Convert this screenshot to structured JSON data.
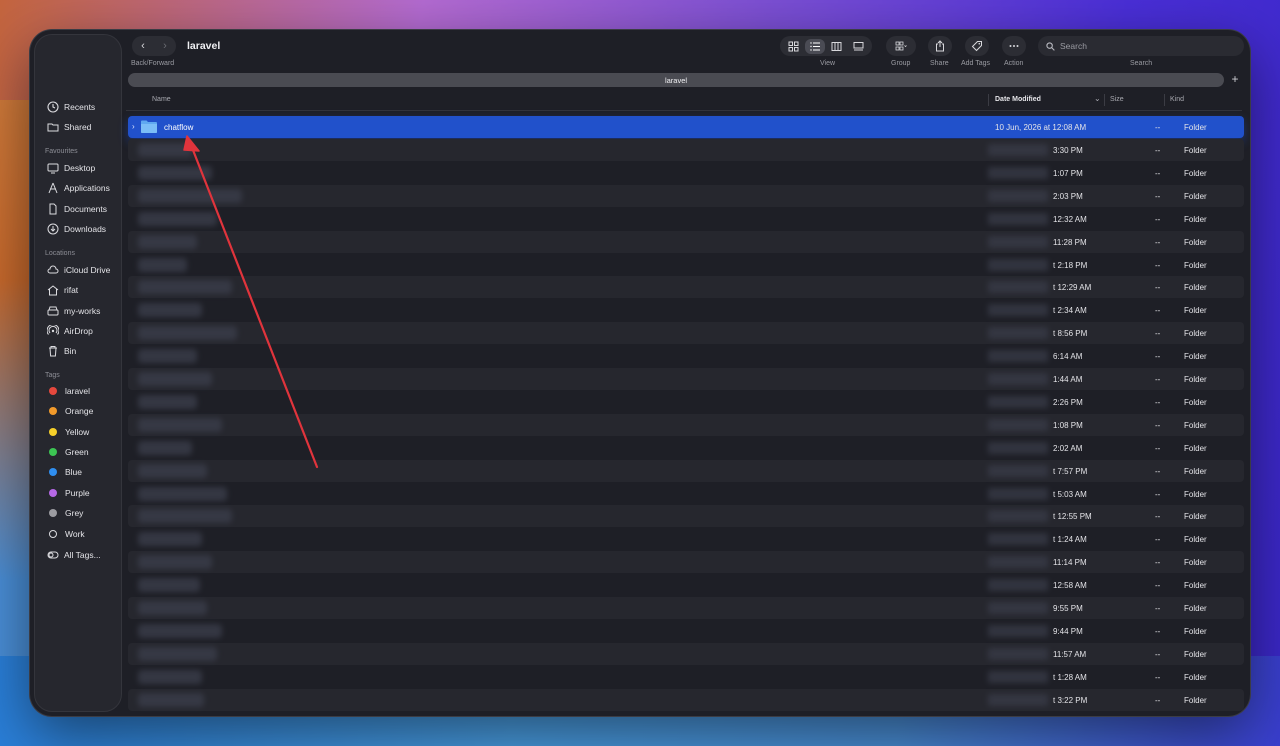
{
  "window": {
    "folder_title": "laravel",
    "back_forward_label": "Back/Forward",
    "view_label": "View",
    "group_label": "Group",
    "share_label": "Share",
    "add_tags_label": "Add Tags",
    "action_label": "Action",
    "search_label": "Search",
    "search_placeholder": "Search",
    "tab_title": "laravel"
  },
  "sidebar": {
    "top_items": [
      {
        "label": "Recents",
        "icon": "clock-icon"
      },
      {
        "label": "Shared",
        "icon": "shared-folder-icon"
      }
    ],
    "favourites_title": "Favourites",
    "favourites": [
      {
        "label": "Desktop",
        "icon": "desktop-icon"
      },
      {
        "label": "Applications",
        "icon": "applications-icon"
      },
      {
        "label": "Documents",
        "icon": "document-icon"
      },
      {
        "label": "Downloads",
        "icon": "download-icon"
      }
    ],
    "locations_title": "Locations",
    "locations": [
      {
        "label": "iCloud Drive",
        "icon": "cloud-icon"
      },
      {
        "label": "rifat",
        "icon": "home-icon"
      },
      {
        "label": "my-works",
        "icon": "drive-icon"
      },
      {
        "label": "AirDrop",
        "icon": "airdrop-icon"
      },
      {
        "label": "Bin",
        "icon": "trash-icon"
      }
    ],
    "tags_title": "Tags",
    "tags": [
      {
        "label": "laravel",
        "color": "#e5483d"
      },
      {
        "label": "Orange",
        "color": "#f19a2b"
      },
      {
        "label": "Yellow",
        "color": "#f5cf2a"
      },
      {
        "label": "Green",
        "color": "#3cc553"
      },
      {
        "label": "Blue",
        "color": "#2f8ef0"
      },
      {
        "label": "Purple",
        "color": "#b668e6"
      },
      {
        "label": "Grey",
        "color": "#9c9ca1"
      },
      {
        "label": "Work",
        "color": ""
      },
      {
        "label": "All Tags...",
        "color": ""
      }
    ]
  },
  "columns": {
    "name": "Name",
    "date_modified": "Date Modified",
    "size": "Size",
    "kind": "Kind"
  },
  "selected_row": {
    "name": "chatflow",
    "date": "10 Jun, 2026 at 12:08 AM",
    "size": "--",
    "kind": "Folder"
  },
  "rows": [
    {
      "date": "3:30 PM",
      "size": "--",
      "kind": "Folder"
    },
    {
      "date": "1:07 PM",
      "size": "--",
      "kind": "Folder"
    },
    {
      "date": "2:03 PM",
      "size": "--",
      "kind": "Folder"
    },
    {
      "date": "12:32 AM",
      "size": "--",
      "kind": "Folder"
    },
    {
      "date": "11:28 PM",
      "size": "--",
      "kind": "Folder"
    },
    {
      "date": "t 2:18 PM",
      "size": "--",
      "kind": "Folder"
    },
    {
      "date": "t 12:29 AM",
      "size": "--",
      "kind": "Folder"
    },
    {
      "date": "t 2:34 AM",
      "size": "--",
      "kind": "Folder"
    },
    {
      "date": "t 8:56 PM",
      "size": "--",
      "kind": "Folder"
    },
    {
      "date": "6:14 AM",
      "size": "--",
      "kind": "Folder"
    },
    {
      "date": "1:44 AM",
      "size": "--",
      "kind": "Folder"
    },
    {
      "date": "2:26 PM",
      "size": "--",
      "kind": "Folder"
    },
    {
      "date": "1:08 PM",
      "size": "--",
      "kind": "Folder"
    },
    {
      "date": "2:02 AM",
      "size": "--",
      "kind": "Folder"
    },
    {
      "date": "t 7:57 PM",
      "size": "--",
      "kind": "Folder"
    },
    {
      "date": "t 5:03 AM",
      "size": "--",
      "kind": "Folder"
    },
    {
      "date": "t 12:55 PM",
      "size": "--",
      "kind": "Folder"
    },
    {
      "date": "t 1:24 AM",
      "size": "--",
      "kind": "Folder"
    },
    {
      "date": "11:14 PM",
      "size": "--",
      "kind": "Folder"
    },
    {
      "date": "12:58 AM",
      "size": "--",
      "kind": "Folder"
    },
    {
      "date": "9:55 PM",
      "size": "--",
      "kind": "Folder"
    },
    {
      "date": "9:44 PM",
      "size": "--",
      "kind": "Folder"
    },
    {
      "date": "11:57 AM",
      "size": "--",
      "kind": "Folder"
    },
    {
      "date": "t 1:28 AM",
      "size": "--",
      "kind": "Folder"
    },
    {
      "date": "t 3:22 PM",
      "size": "--",
      "kind": "Folder"
    }
  ],
  "colors": {
    "selection": "#2151cb",
    "annotation_arrow": "#e0343c"
  }
}
